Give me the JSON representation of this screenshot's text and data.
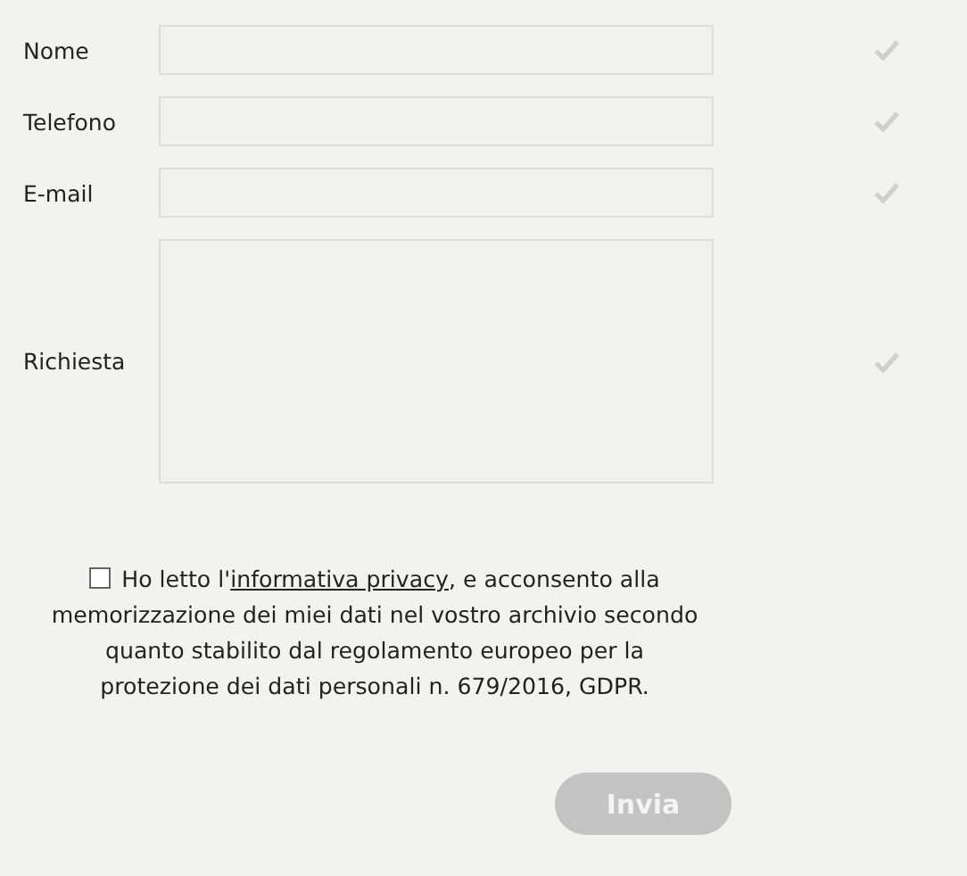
{
  "fields": [
    {
      "label": "Nome",
      "kind": "input"
    },
    {
      "label": "Telefono",
      "kind": "input"
    },
    {
      "label": "E-mail",
      "kind": "input"
    },
    {
      "label": "Richiesta",
      "kind": "textarea"
    }
  ],
  "consent": {
    "checked": false,
    "text_before": "Ho letto l'",
    "link": "informativa privacy",
    "text_after": ", e acconsento alla",
    "lines": [
      "memorizzazione dei miei dati nel vostro archivio secondo",
      "quanto stabilito dal regolamento europeo per la",
      "protezione dei dati personali n. 679/2016, GDPR."
    ]
  },
  "submit": {
    "label": "Invia",
    "disabled": true
  }
}
